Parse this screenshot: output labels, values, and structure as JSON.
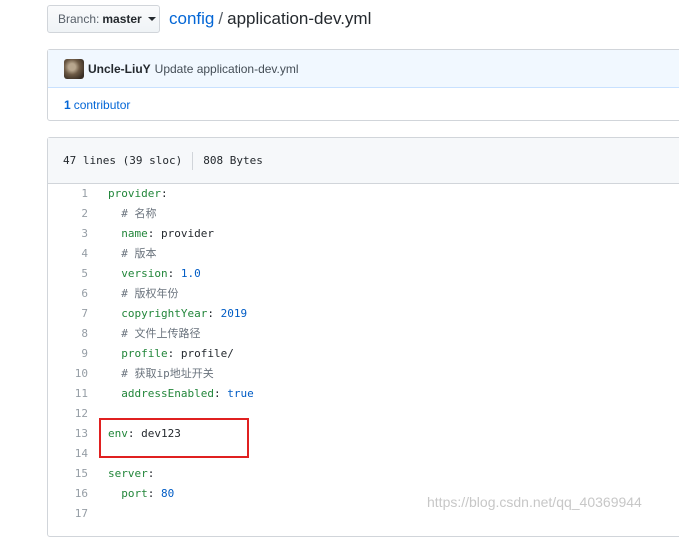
{
  "branch": {
    "label": "Branch:",
    "value": "master"
  },
  "breadcrumb": {
    "repo": "config",
    "separator": "/",
    "file": "application-dev.yml"
  },
  "commit": {
    "author": "Uncle-LiuY",
    "message": "Update application-dev.yml"
  },
  "contributors": {
    "count": "1",
    "label": "contributor"
  },
  "file_info": {
    "lines": "47 lines (39 sloc)",
    "size": "808 Bytes"
  },
  "code_lines": [
    {
      "n": "1",
      "indent": "",
      "key": "provider",
      "value": ""
    },
    {
      "n": "2",
      "indent": "  ",
      "comment": "# 名称"
    },
    {
      "n": "3",
      "indent": "  ",
      "key": "name",
      "value": "provider",
      "vtype": "plain"
    },
    {
      "n": "4",
      "indent": "  ",
      "comment": "# 版本"
    },
    {
      "n": "5",
      "indent": "  ",
      "key": "version",
      "value": "1.0",
      "vtype": "num"
    },
    {
      "n": "6",
      "indent": "  ",
      "comment": "# 版权年份"
    },
    {
      "n": "7",
      "indent": "  ",
      "key": "copyrightYear",
      "value": "2019",
      "vtype": "num"
    },
    {
      "n": "8",
      "indent": "  ",
      "comment": "# 文件上传路径"
    },
    {
      "n": "9",
      "indent": "  ",
      "key": "profile",
      "value": "profile/",
      "vtype": "plain"
    },
    {
      "n": "10",
      "indent": "  ",
      "comment": "# 获取ip地址开关"
    },
    {
      "n": "11",
      "indent": "  ",
      "key": "addressEnabled",
      "value": "true",
      "vtype": "num"
    },
    {
      "n": "12",
      "indent": ""
    },
    {
      "n": "13",
      "indent": "",
      "key": "env",
      "value": "dev123",
      "vtype": "plain"
    },
    {
      "n": "14",
      "indent": ""
    },
    {
      "n": "15",
      "indent": "",
      "key": "server",
      "value": ""
    },
    {
      "n": "16",
      "indent": "  ",
      "key": "port",
      "value": "80",
      "vtype": "num"
    },
    {
      "n": "17",
      "indent": ""
    }
  ],
  "watermark": "https://blog.csdn.net/qq_40369944",
  "colors": {
    "link": "#0366d6",
    "key": "#22863a",
    "number": "#005cc5",
    "highlight_border": "#e02020"
  }
}
